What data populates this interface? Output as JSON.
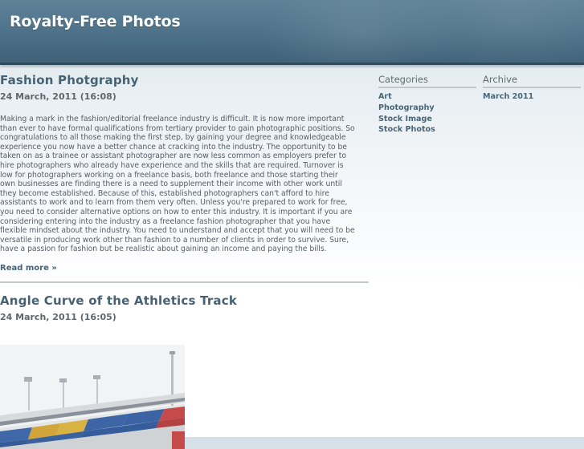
{
  "site": {
    "title": "Royalty-Free Photos"
  },
  "posts": [
    {
      "title": "Fashion Photgraphy",
      "date": "24 March, 2011 (16:08)",
      "lines": [
        "Making a mark in the fashion/editorial freelance industry is difficult. It is now more important",
        "than ever to have formal qualifications from tertiary provider to gain photographic positions. So",
        "congratulations to all those making the first step, by gaining your degree and knowledgeable",
        "experience you now have a better chance at cracking into the industry. The opportunity to be",
        "taken on as a trainee or assistant photographer are now less common as employers prefer to",
        "hire photographers who already have experience and the skills that are required. Turnover is",
        "low for photographers working on a freelance basis, both freelance and those starting their",
        "own businesses are finding there is a need to supplement their income with other work until",
        "they become established. Because of this, established photographers can't afford to hire",
        "assistants to work and to learn from them very often. Unless you're prepared to work for free,",
        "you need to consider alternative options on how to enter this industry. It is important if you are",
        "considering entering into the industry as a freelance fashion photographer that you have",
        "flexible mindset about the industry. You need to understand and accept that you will need to be",
        "versatile in producing work other than fashion to a number of clients in order to survive. Sure,",
        "have a passion for fashion but be realistic about gaining an income and paying the bills."
      ],
      "read_more": "Read more »"
    },
    {
      "title": "Angle Curve of the Athletics Track",
      "date": "24 March, 2011 (16:05)"
    }
  ],
  "sidebar": {
    "categories": {
      "title": "Categories",
      "items": [
        "Art",
        "Photography",
        "Stock Image",
        "Stock Photos"
      ]
    },
    "archive": {
      "title": "Archive",
      "items": [
        "March 2011"
      ]
    }
  }
}
